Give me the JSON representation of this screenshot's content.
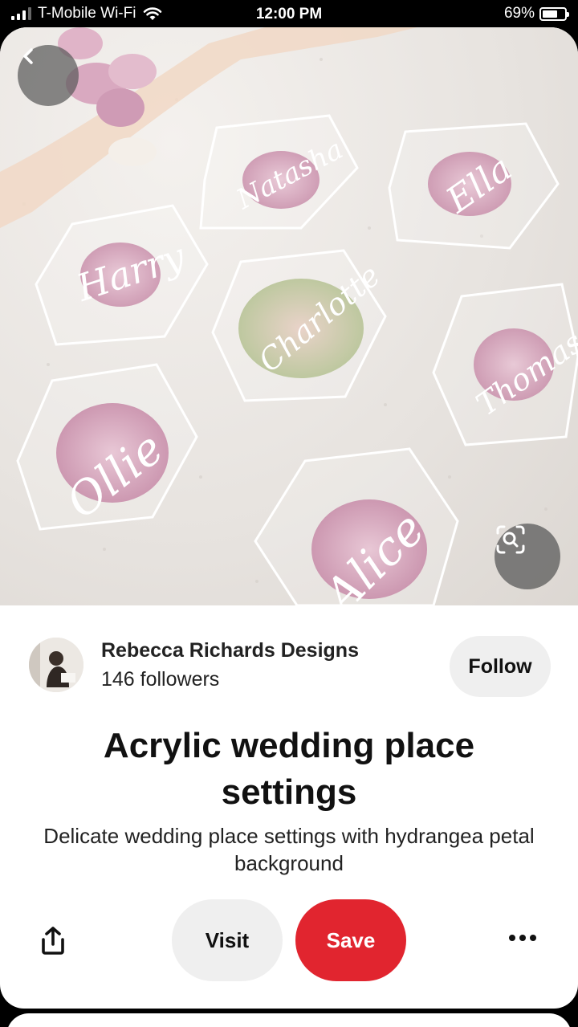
{
  "status_bar": {
    "carrier": "T-Mobile Wi-Fi",
    "time": "12:00 PM",
    "battery": "69%",
    "battery_level": 0.69
  },
  "pin": {
    "image_names": [
      "Natasha",
      "Ella",
      "Harry",
      "Charlotte",
      "Thomas",
      "Ollie",
      "Alice"
    ],
    "creator_name": "Rebecca Richards Designs",
    "followers": "146 followers",
    "follow_label": "Follow",
    "title": "Acrylic wedding place settings",
    "description": "Delicate wedding place settings with hydrangea petal background"
  },
  "actions": {
    "visit_label": "Visit",
    "save_label": "Save"
  },
  "icons": {
    "back": "chevron-left-icon",
    "visual_search": "visual-search-icon",
    "share": "share-icon",
    "more": "more-icon"
  },
  "colors": {
    "save": "#e1252f",
    "button_gray": "#efefef",
    "petal_pink": "#d9a9c0",
    "petal_green": "#c9d2a4"
  }
}
